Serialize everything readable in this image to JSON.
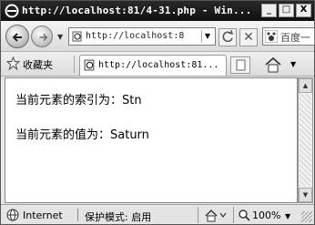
{
  "window": {
    "title": "http://localhost:81/4-31.php - Win...",
    "minimize_label": "_",
    "maximize_label": "□",
    "close_label": "X"
  },
  "nav": {
    "address": "http://localhost:8",
    "search_text": "百度一",
    "stop_label": "✕"
  },
  "favorites": {
    "label": "收藏夹",
    "tab_title": "http://localhost:81..."
  },
  "content": {
    "line1": "当前元素的索引为：Stn",
    "line2": "当前元素的值为：Saturn"
  },
  "status": {
    "zone": "Internet",
    "divider": "|",
    "protected_mode": "保护模式: 启用",
    "zoom": "100%"
  },
  "icons": {
    "title": "ie-icon",
    "back": "back-arrow-icon",
    "forward": "forward-arrow-icon",
    "refresh": "refresh-icon",
    "stop": "stop-icon",
    "search": "baidu-paw-icon",
    "favorites": "star-icon",
    "home": "home-icon",
    "globe": "globe-icon",
    "zoom": "magnifier-icon"
  }
}
